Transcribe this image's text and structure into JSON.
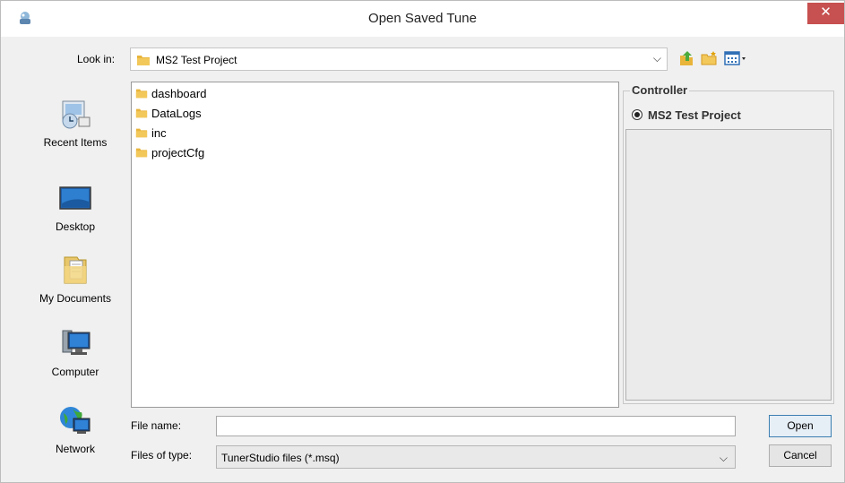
{
  "window": {
    "title": "Open Saved Tune",
    "close_symbol": "✕"
  },
  "toolbar": {
    "look_in_label": "Look in:",
    "look_in_value": "MS2 Test Project",
    "icons": [
      "up-folder-icon",
      "new-folder-icon",
      "view-menu-icon"
    ]
  },
  "places": [
    {
      "label": "Recent Items",
      "icon": "recent-items-icon"
    },
    {
      "label": "Desktop",
      "icon": "desktop-icon"
    },
    {
      "label": "My Documents",
      "icon": "my-documents-icon"
    },
    {
      "label": "Computer",
      "icon": "computer-icon"
    },
    {
      "label": "Network",
      "icon": "network-icon"
    }
  ],
  "files": [
    {
      "name": "dashboard"
    },
    {
      "name": "DataLogs"
    },
    {
      "name": "inc"
    },
    {
      "name": "projectCfg"
    }
  ],
  "controller": {
    "title": "Controller",
    "options": [
      {
        "label": "MS2 Test Project",
        "selected": true
      }
    ]
  },
  "form": {
    "file_name_label": "File name:",
    "file_name_value": "",
    "files_of_type_label": "Files of type:",
    "files_of_type_value": "TunerStudio files (*.msq)"
  },
  "buttons": {
    "open": "Open",
    "cancel": "Cancel"
  },
  "colors": {
    "close_button": "#c75050",
    "folder": "#e8b43a",
    "accent": "#3c7fb1"
  }
}
